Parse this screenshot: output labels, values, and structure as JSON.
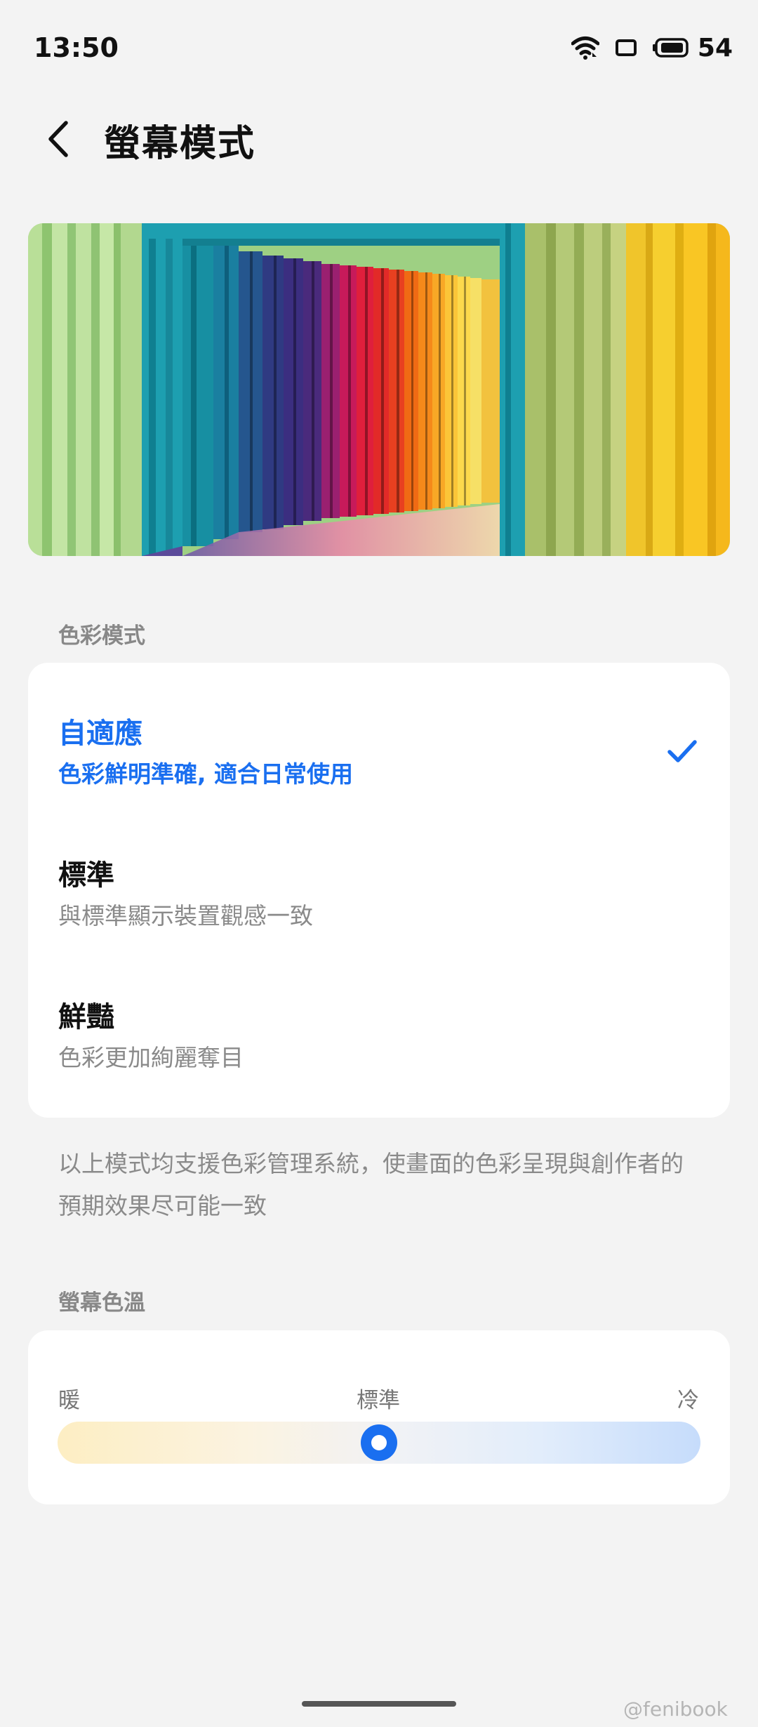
{
  "status_bar": {
    "time": "13:50",
    "battery_level": "54",
    "icons": [
      "wifi-icon",
      "screen-rotation-icon",
      "battery-icon"
    ]
  },
  "header": {
    "back_icon": "chevron-left-icon",
    "title": "螢幕模式"
  },
  "preview": {
    "icon": "colorful-corridor-photo"
  },
  "color_mode": {
    "section_label": "色彩模式",
    "options": [
      {
        "title": "自適應",
        "description": "色彩鮮明準確, 適合日常使用",
        "selected": true
      },
      {
        "title": "標準",
        "description": "與標準顯示裝置觀感一致",
        "selected": false
      },
      {
        "title": "鮮豔",
        "description": "色彩更加絢麗奪目",
        "selected": false
      }
    ],
    "note": "以上模式均支援色彩管理系統，使畫面的色彩呈現與創作者的預期效果尽可能一致"
  },
  "color_temperature": {
    "section_label": "螢幕色溫",
    "warm_label": "暖",
    "standard_label": "標準",
    "cool_label": "冷",
    "value": 0.5
  },
  "watermark": "@fenibook",
  "colors": {
    "accent": "#1a6ff0",
    "background": "#f3f3f3",
    "card": "#ffffff",
    "secondary_text": "#8a8a8a"
  }
}
